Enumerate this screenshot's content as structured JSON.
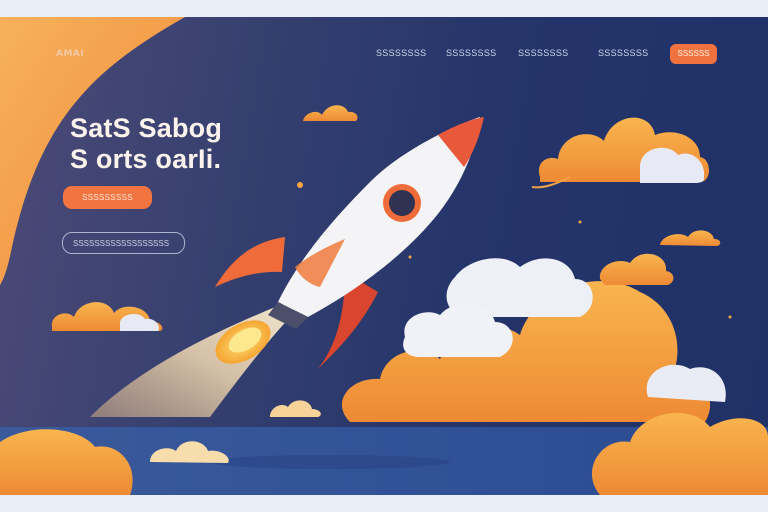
{
  "header": {
    "logo": "AMAI",
    "nav": [
      {
        "label": "SSSSSSSS"
      },
      {
        "label": "SSSSSSSS"
      },
      {
        "label": "SSSSSSSS"
      },
      {
        "label": "SSSSSSSS"
      }
    ],
    "cta_label": "SSSSSS"
  },
  "hero": {
    "title_line1": "SatS Sabog",
    "title_line2": "S orts oarIi.",
    "primary_button": "SSSSSSSSS",
    "input_placeholder": "SSSSSSSSSSSSSSSSSS"
  },
  "colors": {
    "accent": "#f0733f",
    "background_navy": "#1f3168",
    "cloud_orange": "#f7a441",
    "rocket_red": "#d9452e"
  }
}
